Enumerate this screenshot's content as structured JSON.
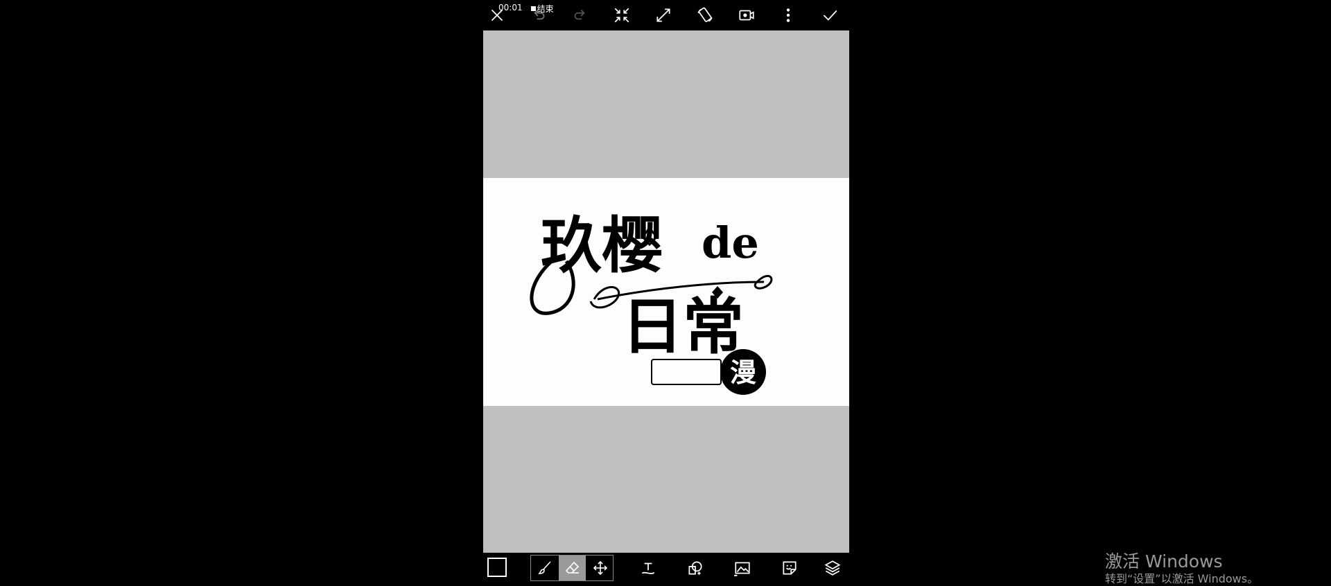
{
  "recording": {
    "timer": "00:01",
    "stop_label": "结束"
  },
  "top_toolbar": {
    "icons": [
      "close-icon",
      "undo-icon",
      "redo-icon",
      "collapse-icon",
      "expand-icon",
      "rotate-screen-icon",
      "record-video-icon",
      "more-vertical-icon",
      "check-icon"
    ]
  },
  "canvas": {
    "artwork": {
      "title_line1": "玖樱",
      "title_de": "de",
      "title_line2": "日常",
      "badge": "漫"
    },
    "colors": {
      "canvas_bg": "#bfc0bf",
      "artwork_bg": "#fdfdfb",
      "ink": "#000000"
    }
  },
  "bottom_toolbar": {
    "current_color": "#000000",
    "tools": [
      "brush-icon",
      "eraser-icon",
      "move-icon"
    ],
    "active_tool": "eraser-icon",
    "icons": [
      "text-icon",
      "shape-icon",
      "image-icon",
      "sticker-icon",
      "layers-icon"
    ]
  },
  "watermark": {
    "line1": "激活 Windows",
    "line2": "转到“设置”以激活 Windows。"
  }
}
